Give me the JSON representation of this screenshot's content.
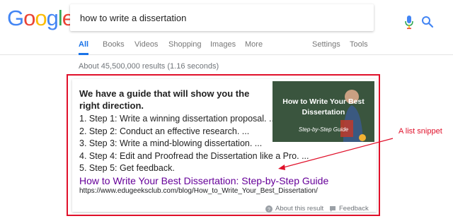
{
  "logo": {
    "letters": [
      "G",
      "o",
      "o",
      "g",
      "l",
      "e"
    ],
    "colors": [
      "#4285F4",
      "#EA4335",
      "#FBBC05",
      "#4285F4",
      "#34A853",
      "#EA4335"
    ]
  },
  "search": {
    "query": "how to write a dissertation"
  },
  "tabs": {
    "all": "All",
    "books": "Books",
    "videos": "Videos",
    "shopping": "Shopping",
    "images": "Images",
    "more": "More",
    "settings": "Settings",
    "tools": "Tools"
  },
  "results": {
    "stats": "About 45,500,000 results (1.16 seconds)",
    "snippet": {
      "heading": "We have a guide that will show you the right direction.",
      "steps": [
        "1. Step 1: Write a winning dissertation proposal. ...",
        "2. Step 2: Conduct an effective research. ...",
        "3. Step 3: Write a mind-blowing dissertation. ...",
        "4. Step 4: Edit and Proofread the Dissertation like a Pro. ...",
        "5. Step 5: Get feedback."
      ],
      "thumbnail": {
        "title": "How to Write Your Best Dissertation",
        "subtitle": "Step-by-Step Guide"
      },
      "link_title": "How to Write Your Best Dissertation: Step-by-Step Guide",
      "url": "https://www.edugeeksclub.com/blog/How_to_Write_Your_Best_Dissertation/",
      "about": "About this result",
      "feedback": "Feedback"
    }
  },
  "annotation": {
    "text": "A list snippet",
    "color": "#e0102a"
  },
  "colors": {
    "accent": "#1a73e8",
    "visited_link": "#660099",
    "highlight_frame": "#e0102a"
  }
}
